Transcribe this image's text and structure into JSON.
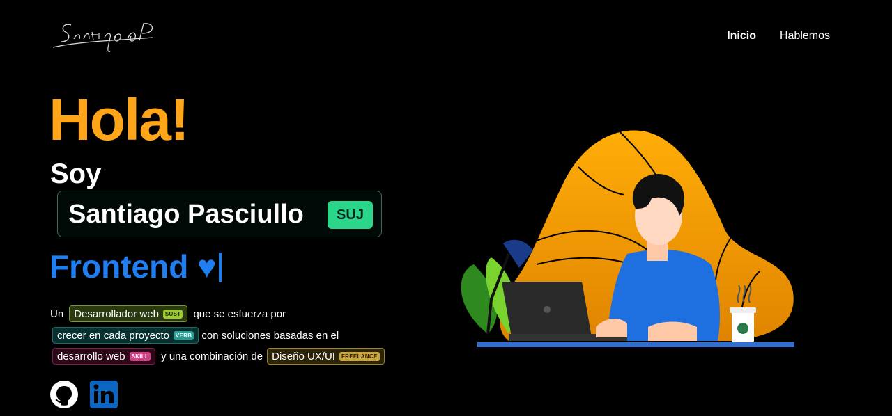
{
  "logo": {
    "signature": "SantiagoP"
  },
  "nav": {
    "items": [
      {
        "label": "Inicio"
      },
      {
        "label": "Hablemos"
      }
    ]
  },
  "hero": {
    "greeting": "Hola!",
    "intro": "Soy",
    "name": "Santiago Pasciullo",
    "name_badge": "SUJ",
    "role": "Frontend ♥"
  },
  "description": {
    "line1": {
      "prefix": "Un",
      "chip": "Desarrollador web",
      "chip_tag": "SUST",
      "suffix": "que se esfuerza por"
    },
    "line2": {
      "chip": "crecer en cada proyecto",
      "chip_tag": "VERB",
      "suffix": "con soluciones basadas en el"
    },
    "line3": {
      "chip": "desarrollo web",
      "chip_tag": "SKILL",
      "middle": "y una combinación de",
      "chip2": "Diseño UX/UI",
      "chip2_tag": "FREELANCE"
    }
  },
  "social": [
    {
      "icon": "github-icon"
    },
    {
      "icon": "linkedin-icon"
    }
  ],
  "colors": {
    "accent_orange": "#ffa51a",
    "accent_blue": "#1f7ff2",
    "badge_green": "#2bd68a"
  }
}
